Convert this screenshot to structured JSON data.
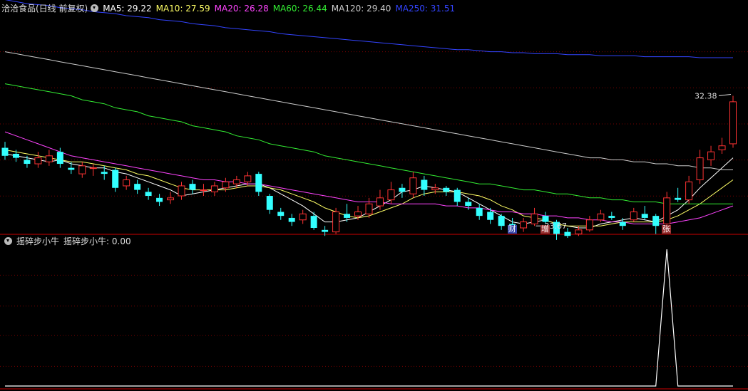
{
  "header": {
    "title": "洽洽食品(日线 前复权)",
    "ma": [
      {
        "label": "MA5: 29.22",
        "color": "#ffffff"
      },
      {
        "label": "MA10: 27.59",
        "color": "#ffff66"
      },
      {
        "label": "MA20: 26.28",
        "color": "#ff44ff"
      },
      {
        "label": "MA60: 26.44",
        "color": "#33ee33"
      },
      {
        "label": "MA120: 29.40",
        "color": "#cccccc"
      },
      {
        "label": "MA250: 31.51",
        "color": "#3344ff"
      }
    ]
  },
  "indicator": {
    "name": "摇碎步小牛",
    "value_label": "摇碎步小牛: 0.00"
  },
  "markers": [
    {
      "text": "财",
      "bg": "#3344aa",
      "color": "#ffffff",
      "index": 46
    },
    {
      "text": "增",
      "bg": "#993333",
      "color": "#ffffff",
      "index": 49
    },
    {
      "text": "张",
      "bg": "#993333",
      "color": "#ffffff",
      "index": 60
    }
  ],
  "colors": {
    "up": "#ff3333",
    "down": "#33ffff",
    "grid": "#7a0000",
    "separator": "#cc0000"
  },
  "chart_data": {
    "type": "candlestick",
    "price_range": [
      23.0,
      33.6
    ],
    "annotations": [
      {
        "text": "32.38",
        "kind": "high",
        "index": 66
      },
      {
        "text": "23.67",
        "kind": "low",
        "index": 48
      }
    ],
    "candles": [
      [
        27.0,
        26.6,
        27.3,
        26.4
      ],
      [
        26.7,
        26.5,
        26.9,
        26.3
      ],
      [
        26.4,
        26.2,
        26.6,
        26.0
      ],
      [
        26.2,
        26.5,
        26.8,
        26.0
      ],
      [
        26.3,
        26.6,
        26.9,
        26.1
      ],
      [
        26.8,
        26.2,
        27.0,
        26.0
      ],
      [
        26.0,
        25.9,
        26.3,
        25.7
      ],
      [
        25.7,
        26.1,
        26.3,
        25.5
      ],
      [
        26.0,
        26.0,
        26.2,
        25.6
      ],
      [
        25.8,
        25.7,
        26.1,
        25.4
      ],
      [
        25.9,
        25.0,
        26.0,
        24.8
      ],
      [
        25.1,
        25.4,
        25.6,
        24.9
      ],
      [
        25.2,
        24.9,
        25.4,
        24.7
      ],
      [
        24.8,
        24.6,
        25.0,
        24.4
      ],
      [
        24.5,
        24.3,
        24.7,
        24.1
      ],
      [
        24.4,
        24.5,
        24.8,
        24.2
      ],
      [
        24.6,
        25.1,
        25.3,
        24.4
      ],
      [
        25.2,
        24.9,
        25.4,
        24.7
      ],
      [
        24.9,
        24.9,
        25.2,
        24.6
      ],
      [
        24.8,
        25.1,
        25.3,
        24.6
      ],
      [
        25.0,
        25.3,
        25.5,
        24.8
      ],
      [
        25.2,
        25.4,
        25.6,
        25.0
      ],
      [
        25.3,
        25.6,
        25.8,
        25.1
      ],
      [
        25.7,
        24.8,
        25.8,
        24.6
      ],
      [
        24.6,
        23.9,
        24.7,
        23.7
      ],
      [
        23.8,
        23.6,
        24.0,
        23.4
      ],
      [
        23.5,
        23.3,
        23.7,
        23.1
      ],
      [
        23.4,
        23.7,
        23.9,
        23.2
      ],
      [
        23.6,
        23.0,
        23.8,
        22.9
      ],
      [
        22.9,
        22.8,
        23.1,
        22.6
      ],
      [
        22.8,
        23.8,
        24.0,
        22.7
      ],
      [
        23.7,
        23.5,
        24.2,
        23.3
      ],
      [
        23.6,
        23.8,
        24.1,
        23.4
      ],
      [
        23.7,
        24.2,
        24.5,
        23.5
      ],
      [
        24.1,
        24.5,
        24.9,
        23.9
      ],
      [
        24.4,
        24.9,
        25.3,
        24.2
      ],
      [
        25.0,
        24.8,
        25.2,
        24.5
      ],
      [
        24.7,
        25.5,
        25.8,
        24.5
      ],
      [
        25.4,
        24.9,
        25.6,
        24.6
      ],
      [
        24.9,
        25.0,
        25.2,
        24.7
      ],
      [
        25.0,
        24.8,
        25.1,
        24.6
      ],
      [
        24.9,
        24.3,
        25.0,
        24.1
      ],
      [
        24.3,
        24.1,
        24.5,
        23.9
      ],
      [
        24.0,
        23.6,
        24.2,
        23.4
      ],
      [
        23.8,
        23.4,
        24.0,
        23.2
      ],
      [
        23.6,
        23.1,
        23.7,
        22.9
      ],
      [
        23.2,
        23.1,
        23.5,
        23.0
      ],
      [
        23.0,
        23.3,
        23.5,
        22.8
      ],
      [
        23.2,
        23.7,
        24.0,
        23.1
      ],
      [
        23.6,
        23.3,
        23.8,
        23.2
      ],
      [
        23.3,
        22.7,
        23.4,
        22.4
      ],
      [
        22.8,
        22.6,
        23.0,
        22.5
      ],
      [
        22.7,
        22.9,
        23.1,
        22.6
      ],
      [
        22.9,
        23.4,
        23.6,
        22.8
      ],
      [
        23.4,
        23.7,
        23.9,
        23.3
      ],
      [
        23.6,
        23.5,
        23.8,
        23.4
      ],
      [
        23.3,
        23.1,
        23.5,
        22.9
      ],
      [
        23.4,
        23.8,
        24.0,
        23.3
      ],
      [
        23.7,
        23.5,
        24.1,
        23.4
      ],
      [
        23.6,
        23.1,
        23.7,
        22.7
      ],
      [
        23.2,
        24.5,
        24.8,
        23.1
      ],
      [
        24.5,
        24.4,
        25.0,
        24.3
      ],
      [
        24.4,
        25.3,
        25.6,
        24.2
      ],
      [
        25.4,
        26.5,
        26.9,
        25.2
      ],
      [
        26.4,
        26.8,
        27.1,
        26.1
      ],
      [
        26.9,
        27.1,
        27.5,
        26.7
      ],
      [
        27.2,
        29.3,
        29.6,
        27.0
      ]
    ],
    "ma_lines": [
      {
        "name": "MA5",
        "color": "#ffffff",
        "values": [
          26.7,
          26.6,
          26.5,
          26.4,
          26.3,
          26.4,
          26.2,
          26.1,
          26.0,
          26.0,
          25.8,
          25.7,
          25.5,
          25.3,
          25.1,
          24.9,
          24.6,
          24.7,
          24.8,
          24.9,
          25.0,
          25.1,
          25.2,
          25.2,
          25.0,
          24.7,
          24.4,
          24.1,
          23.7,
          23.3,
          23.3,
          23.4,
          23.5,
          23.8,
          24.1,
          24.4,
          24.8,
          24.9,
          25.1,
          25.0,
          24.9,
          24.8,
          24.5,
          24.2,
          23.9,
          23.6,
          23.3,
          23.2,
          23.3,
          23.4,
          23.2,
          23.1,
          23.0,
          23.0,
          23.2,
          23.3,
          23.4,
          23.5,
          23.4,
          23.3,
          23.6,
          23.9,
          24.4,
          25.0,
          25.5,
          26.0,
          26.5
        ]
      },
      {
        "name": "MA10",
        "color": "#ffff66",
        "values": [
          26.9,
          26.8,
          26.7,
          26.6,
          26.5,
          26.4,
          26.3,
          26.3,
          26.2,
          26.1,
          26.0,
          25.9,
          25.7,
          25.6,
          25.4,
          25.2,
          25.0,
          24.9,
          24.9,
          24.9,
          24.9,
          25.0,
          25.1,
          25.1,
          25.0,
          24.9,
          24.7,
          24.5,
          24.3,
          24.0,
          23.8,
          23.6,
          23.5,
          23.6,
          23.8,
          24.0,
          24.2,
          24.5,
          24.7,
          24.8,
          24.8,
          24.8,
          24.7,
          24.6,
          24.4,
          24.1,
          23.9,
          23.6,
          23.5,
          23.4,
          23.2,
          23.1,
          23.1,
          23.1,
          23.1,
          23.2,
          23.3,
          23.3,
          23.3,
          23.3,
          23.4,
          23.6,
          23.9,
          24.2,
          24.6,
          25.0,
          25.4
        ]
      },
      {
        "name": "MA20",
        "color": "#ff44ff",
        "values": [
          27.8,
          27.6,
          27.4,
          27.2,
          27.0,
          26.8,
          26.6,
          26.5,
          26.4,
          26.3,
          26.2,
          26.1,
          26.0,
          25.9,
          25.8,
          25.7,
          25.6,
          25.5,
          25.4,
          25.4,
          25.3,
          25.3,
          25.2,
          25.2,
          25.1,
          25.0,
          24.9,
          24.8,
          24.7,
          24.6,
          24.5,
          24.4,
          24.3,
          24.3,
          24.3,
          24.2,
          24.2,
          24.2,
          24.2,
          24.2,
          24.1,
          24.1,
          24.0,
          24.0,
          23.9,
          23.8,
          23.8,
          23.7,
          23.7,
          23.6,
          23.6,
          23.5,
          23.5,
          23.4,
          23.4,
          23.3,
          23.3,
          23.2,
          23.2,
          23.2,
          23.2,
          23.3,
          23.4,
          23.5,
          23.7,
          23.9,
          24.1
        ]
      },
      {
        "name": "MA60",
        "color": "#33ee33",
        "values": [
          30.2,
          30.1,
          30.0,
          29.9,
          29.8,
          29.7,
          29.6,
          29.4,
          29.3,
          29.2,
          29.0,
          28.9,
          28.8,
          28.6,
          28.5,
          28.4,
          28.3,
          28.1,
          28.0,
          27.9,
          27.8,
          27.6,
          27.5,
          27.4,
          27.2,
          27.1,
          27.0,
          26.9,
          26.8,
          26.6,
          26.5,
          26.4,
          26.3,
          26.2,
          26.1,
          26.0,
          25.9,
          25.8,
          25.7,
          25.6,
          25.5,
          25.4,
          25.3,
          25.2,
          25.2,
          25.1,
          25.0,
          24.9,
          24.9,
          24.8,
          24.7,
          24.7,
          24.6,
          24.5,
          24.5,
          24.4,
          24.4,
          24.3,
          24.3,
          24.3,
          24.2,
          24.2,
          24.2,
          24.2,
          24.2,
          24.2,
          24.2
        ]
      },
      {
        "name": "MA120",
        "color": "#cccccc",
        "values": [
          31.8,
          31.7,
          31.6,
          31.5,
          31.4,
          31.3,
          31.2,
          31.1,
          31.0,
          30.9,
          30.8,
          30.7,
          30.6,
          30.5,
          30.4,
          30.3,
          30.2,
          30.1,
          30.0,
          29.9,
          29.8,
          29.7,
          29.6,
          29.5,
          29.4,
          29.3,
          29.2,
          29.1,
          29.0,
          28.9,
          28.8,
          28.7,
          28.6,
          28.5,
          28.4,
          28.3,
          28.2,
          28.1,
          28.0,
          27.9,
          27.8,
          27.7,
          27.6,
          27.5,
          27.4,
          27.3,
          27.2,
          27.1,
          27.0,
          26.9,
          26.8,
          26.7,
          26.6,
          26.5,
          26.5,
          26.4,
          26.4,
          26.3,
          26.3,
          26.2,
          26.2,
          26.1,
          26.1,
          26.0,
          26.0,
          25.9,
          25.9
        ]
      },
      {
        "name": "MA250",
        "color": "#3344ff",
        "values": [
          34.4,
          34.3,
          34.2,
          34.15,
          34.1,
          34.0,
          33.95,
          33.9,
          33.8,
          33.75,
          33.7,
          33.6,
          33.55,
          33.5,
          33.4,
          33.35,
          33.3,
          33.2,
          33.15,
          33.1,
          33.0,
          32.95,
          32.9,
          32.85,
          32.8,
          32.7,
          32.65,
          32.6,
          32.55,
          32.5,
          32.45,
          32.4,
          32.35,
          32.3,
          32.25,
          32.2,
          32.15,
          32.1,
          32.05,
          32.0,
          31.95,
          31.9,
          31.9,
          31.85,
          31.8,
          31.8,
          31.75,
          31.75,
          31.7,
          31.7,
          31.7,
          31.65,
          31.65,
          31.65,
          31.6,
          31.6,
          31.6,
          31.6,
          31.55,
          31.55,
          31.55,
          31.55,
          31.55,
          31.5,
          31.5,
          31.5,
          31.5
        ]
      }
    ],
    "indicator_series": {
      "range": [
        0,
        1
      ],
      "values": [
        0,
        0,
        0,
        0,
        0,
        0,
        0,
        0,
        0,
        0,
        0,
        0,
        0,
        0,
        0,
        0,
        0,
        0,
        0,
        0,
        0,
        0,
        0,
        0,
        0,
        0,
        0,
        0,
        0,
        0,
        0,
        0,
        0,
        0,
        0,
        0,
        0,
        0,
        0,
        0,
        0,
        0,
        0,
        0,
        0,
        0,
        0,
        0,
        0,
        0,
        0,
        0,
        0,
        0,
        0,
        0,
        0,
        0,
        0,
        0,
        1,
        0,
        0,
        0,
        0,
        0,
        0
      ]
    }
  }
}
